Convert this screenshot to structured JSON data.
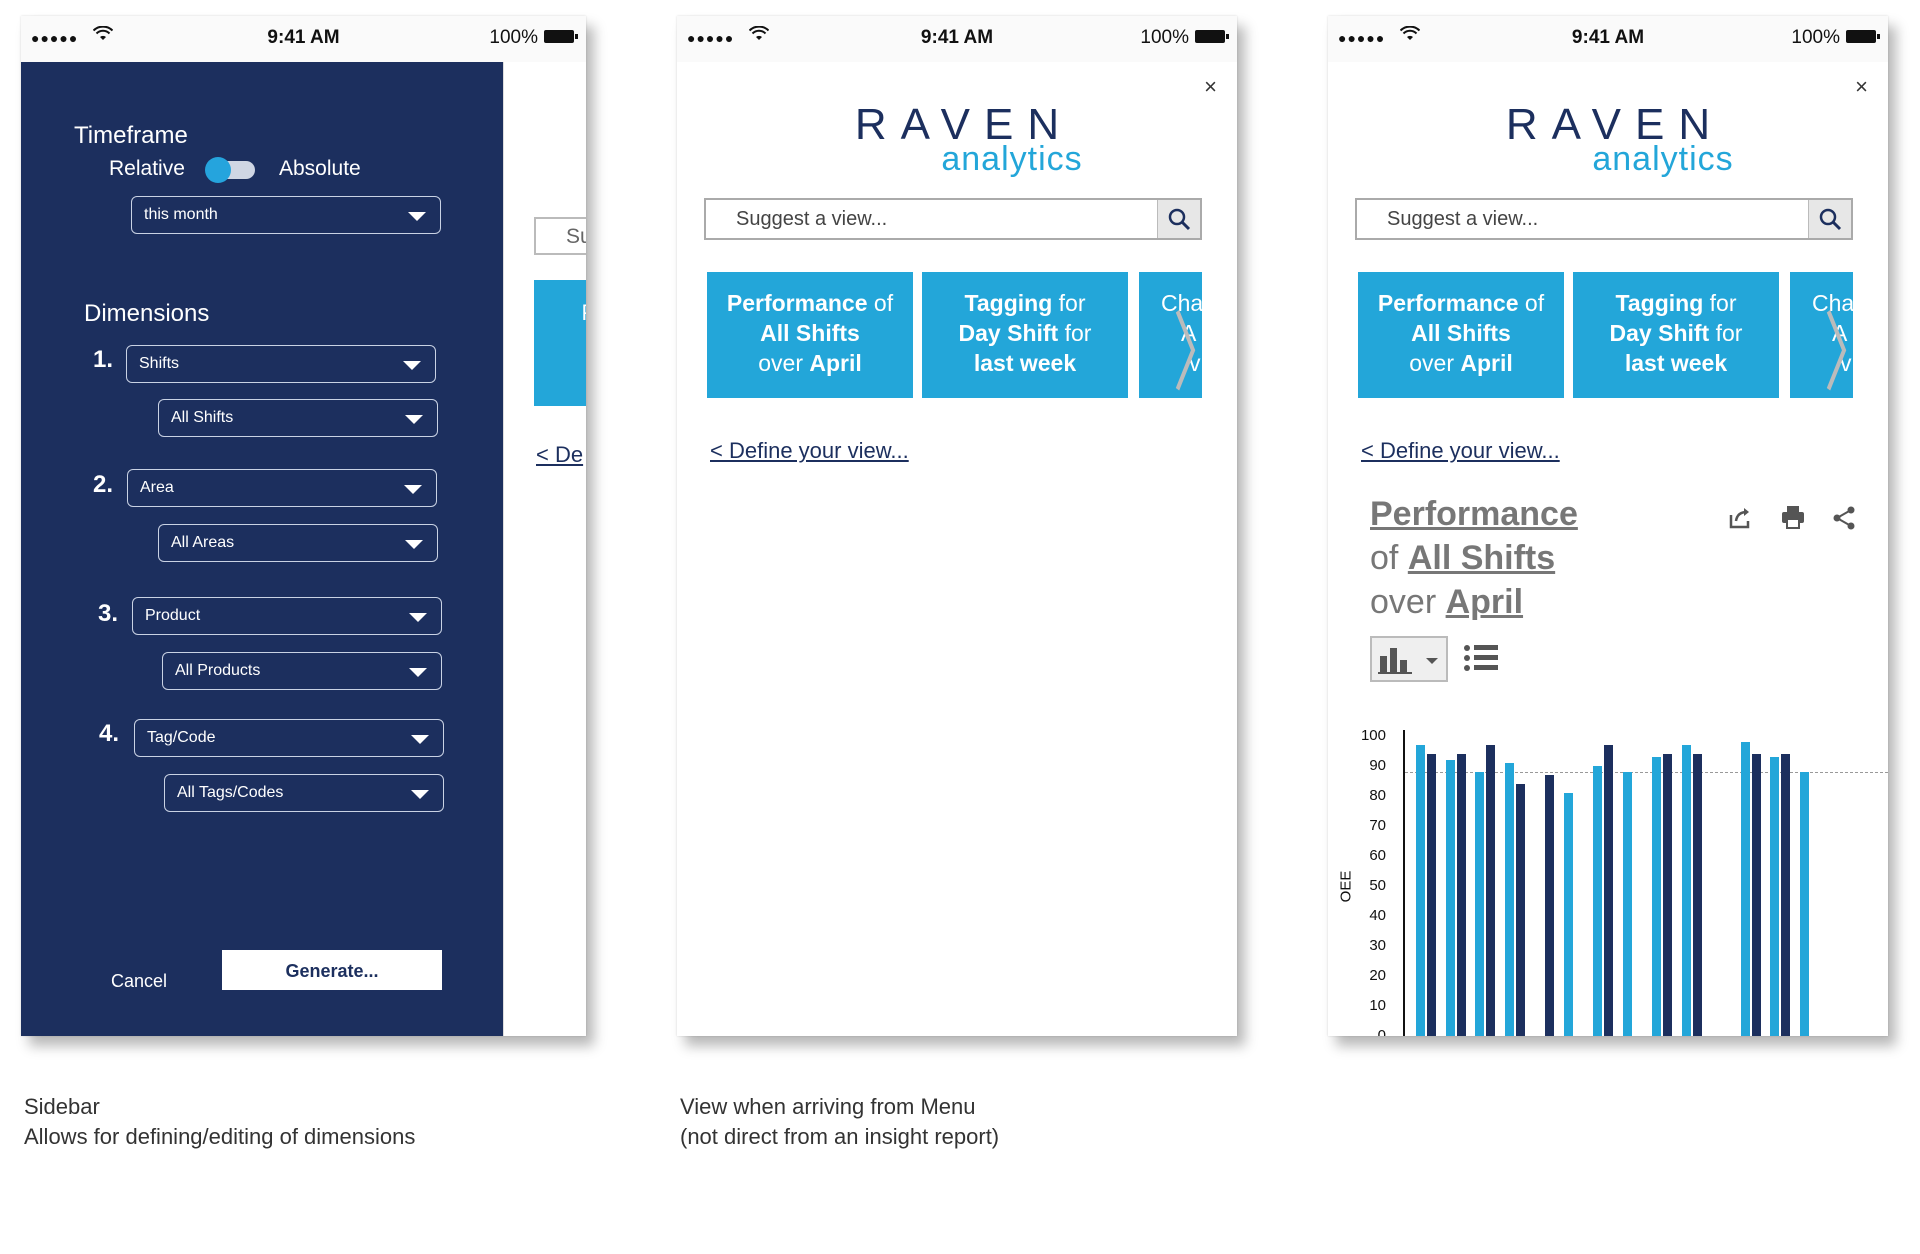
{
  "status": {
    "time": "9:41 AM",
    "battery": "100%"
  },
  "sidebar": {
    "timeframe_heading": "Timeframe",
    "relative_label": "Relative",
    "absolute_label": "Absolute",
    "timeframe_value": "this month",
    "dimensions_heading": "Dimensions",
    "dimensions": [
      {
        "num": "1.",
        "dimension": "Shifts",
        "value": "All Shifts"
      },
      {
        "num": "2.",
        "dimension": "Area",
        "value": "All Areas"
      },
      {
        "num": "3.",
        "dimension": "Product",
        "value": "All Products"
      },
      {
        "num": "4.",
        "dimension": "Tag/Code",
        "value": "All Tags/Codes"
      }
    ],
    "cancel_label": "Cancel",
    "generate_label": "Generate...",
    "behind_suggest": "Su",
    "behind_tile": "Pe",
    "behind_link": "< De"
  },
  "app": {
    "close": "×",
    "logo_top": "RAVEN",
    "logo_bottom": "analytics",
    "search_placeholder": "Suggest a view...",
    "define_link": "< Define your view...",
    "tiles": [
      {
        "lines": [
          [
            "Performance",
            " of"
          ],
          [
            "All Shifts"
          ],
          [
            "over ",
            "April"
          ]
        ]
      },
      {
        "lines": [
          [
            "Tagging",
            " for"
          ],
          [
            "Day Shift",
            " for"
          ],
          [
            "last week"
          ]
        ]
      },
      {
        "lines": [
          [
            "Cha"
          ],
          [
            "A"
          ],
          [
            "v"
          ]
        ]
      }
    ]
  },
  "report": {
    "title_l1": "Performance",
    "title_l2_pre": "of",
    "title_l2": "All Shifts",
    "title_l3_pre": "over",
    "title_l3": "April"
  },
  "captions": {
    "sidebar_l1": "Sidebar",
    "sidebar_l2": "Allows for defining/editing of dimensions",
    "menu_l1": "View when arriving from Menu",
    "menu_l2": "(not direct from an insight report)"
  },
  "colors": {
    "navy": "#1c2f5e",
    "accent": "#23a6d9"
  },
  "chart_data": {
    "type": "bar",
    "ylabel": "OEE",
    "ylim": [
      0,
      100
    ],
    "yticks": [
      "100",
      "90",
      "80",
      "70",
      "60",
      "50",
      "40",
      "30",
      "20",
      "10",
      "0"
    ],
    "reference_line": 88,
    "series": [
      {
        "color": "#23a6d9",
        "values": [
          97,
          92,
          88,
          91,
          null,
          81,
          90,
          88,
          93,
          97,
          null,
          98,
          93,
          88
        ]
      },
      {
        "color": "#1c2f5e",
        "values": [
          94,
          94,
          97,
          84,
          87,
          null,
          97,
          null,
          94,
          94,
          null,
          94,
          94,
          null
        ]
      }
    ]
  }
}
